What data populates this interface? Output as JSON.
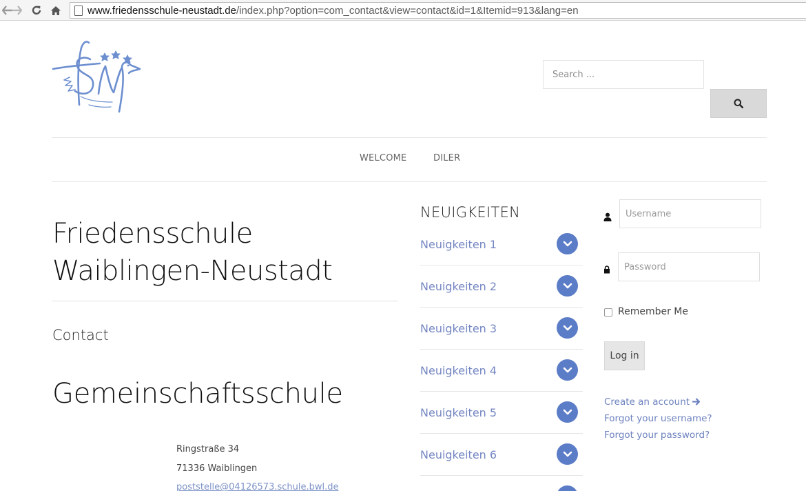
{
  "browser": {
    "url_host": "www.friedensschule-neustadt.de",
    "url_path": "/index.php?option=com_contact&view=contact&id=1&Itemid=913&lang=en"
  },
  "header": {
    "search_placeholder": "Search ...",
    "logo_alt": "Friedensschule Neustadt logo"
  },
  "menu": {
    "items": [
      {
        "label": "WELCOME"
      },
      {
        "label": "DILER"
      }
    ]
  },
  "main": {
    "site_title_line1": "Friedensschule",
    "site_title_line2": "Waiblingen-Neustadt",
    "contact_heading": "Contact",
    "school_heading": "Gemeinschaftsschule",
    "address": {
      "street": "Ringstraße 34",
      "city": "71336 Waiblingen",
      "email": "poststelle@04126573.schule.bwl.de"
    }
  },
  "news": {
    "title": "NEUIGKEITEN",
    "items": [
      {
        "label": "Neuigkeiten 1"
      },
      {
        "label": "Neuigkeiten 2"
      },
      {
        "label": "Neuigkeiten 3"
      },
      {
        "label": "Neuigkeiten 4"
      },
      {
        "label": "Neuigkeiten 5"
      },
      {
        "label": "Neuigkeiten 6"
      }
    ]
  },
  "login": {
    "username_placeholder": "Username",
    "password_placeholder": "Password",
    "remember_label": "Remember Me",
    "login_button": "Log in",
    "create_account": "Create an account",
    "forgot_username": "Forgot your username?",
    "forgot_password": "Forgot your password?"
  },
  "colors": {
    "accent": "#5b7cc6",
    "link": "#6d82bf",
    "logo": "#6d8fd0"
  }
}
